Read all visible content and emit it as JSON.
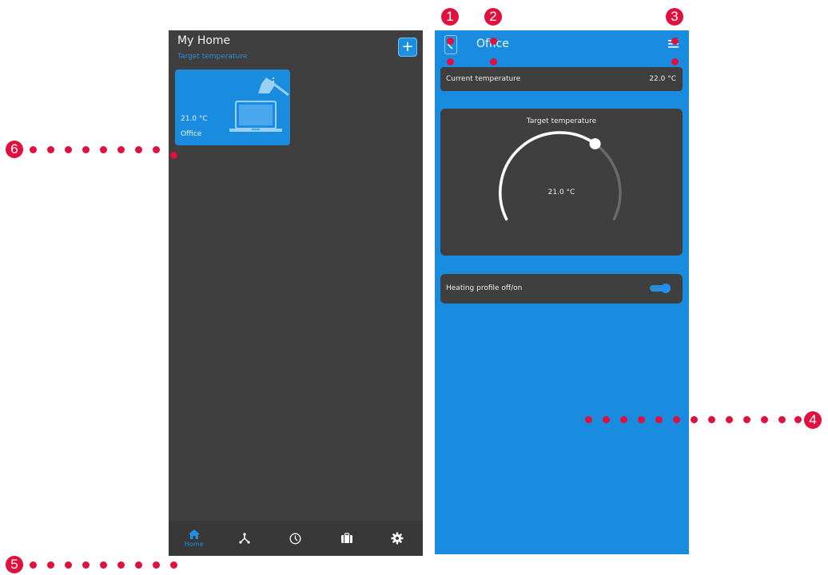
{
  "left_screen": {
    "title": "My Home",
    "subtitle": "Target temperature",
    "add_button_label": "+",
    "room_card": {
      "temperature": "21.0 °C",
      "name": "Office"
    },
    "nav": [
      {
        "label": "Home",
        "icon": "home-icon",
        "active": true
      },
      {
        "label": "",
        "icon": "network-icon",
        "active": false
      },
      {
        "label": "",
        "icon": "clock-icon",
        "active": false
      },
      {
        "label": "",
        "icon": "briefcase-icon",
        "active": false
      },
      {
        "label": "",
        "icon": "gear-icon",
        "active": false
      }
    ]
  },
  "right_screen": {
    "title": "Office",
    "current_temperature": {
      "label": "Current temperature",
      "value": "22.0 °C"
    },
    "target_temperature": {
      "label": "Target temperature",
      "value": "21.0 °C"
    },
    "heating_profile": {
      "label": "Heating profile off/on",
      "enabled": true
    }
  },
  "callouts": {
    "m1": "1",
    "m2": "2",
    "m3": "3",
    "m4": "4",
    "m5": "5",
    "m6": "6"
  },
  "colors": {
    "accent_blue": "#1a8ce0",
    "panel_dark": "#3f3f3f",
    "callout_red": "#e0103f"
  }
}
